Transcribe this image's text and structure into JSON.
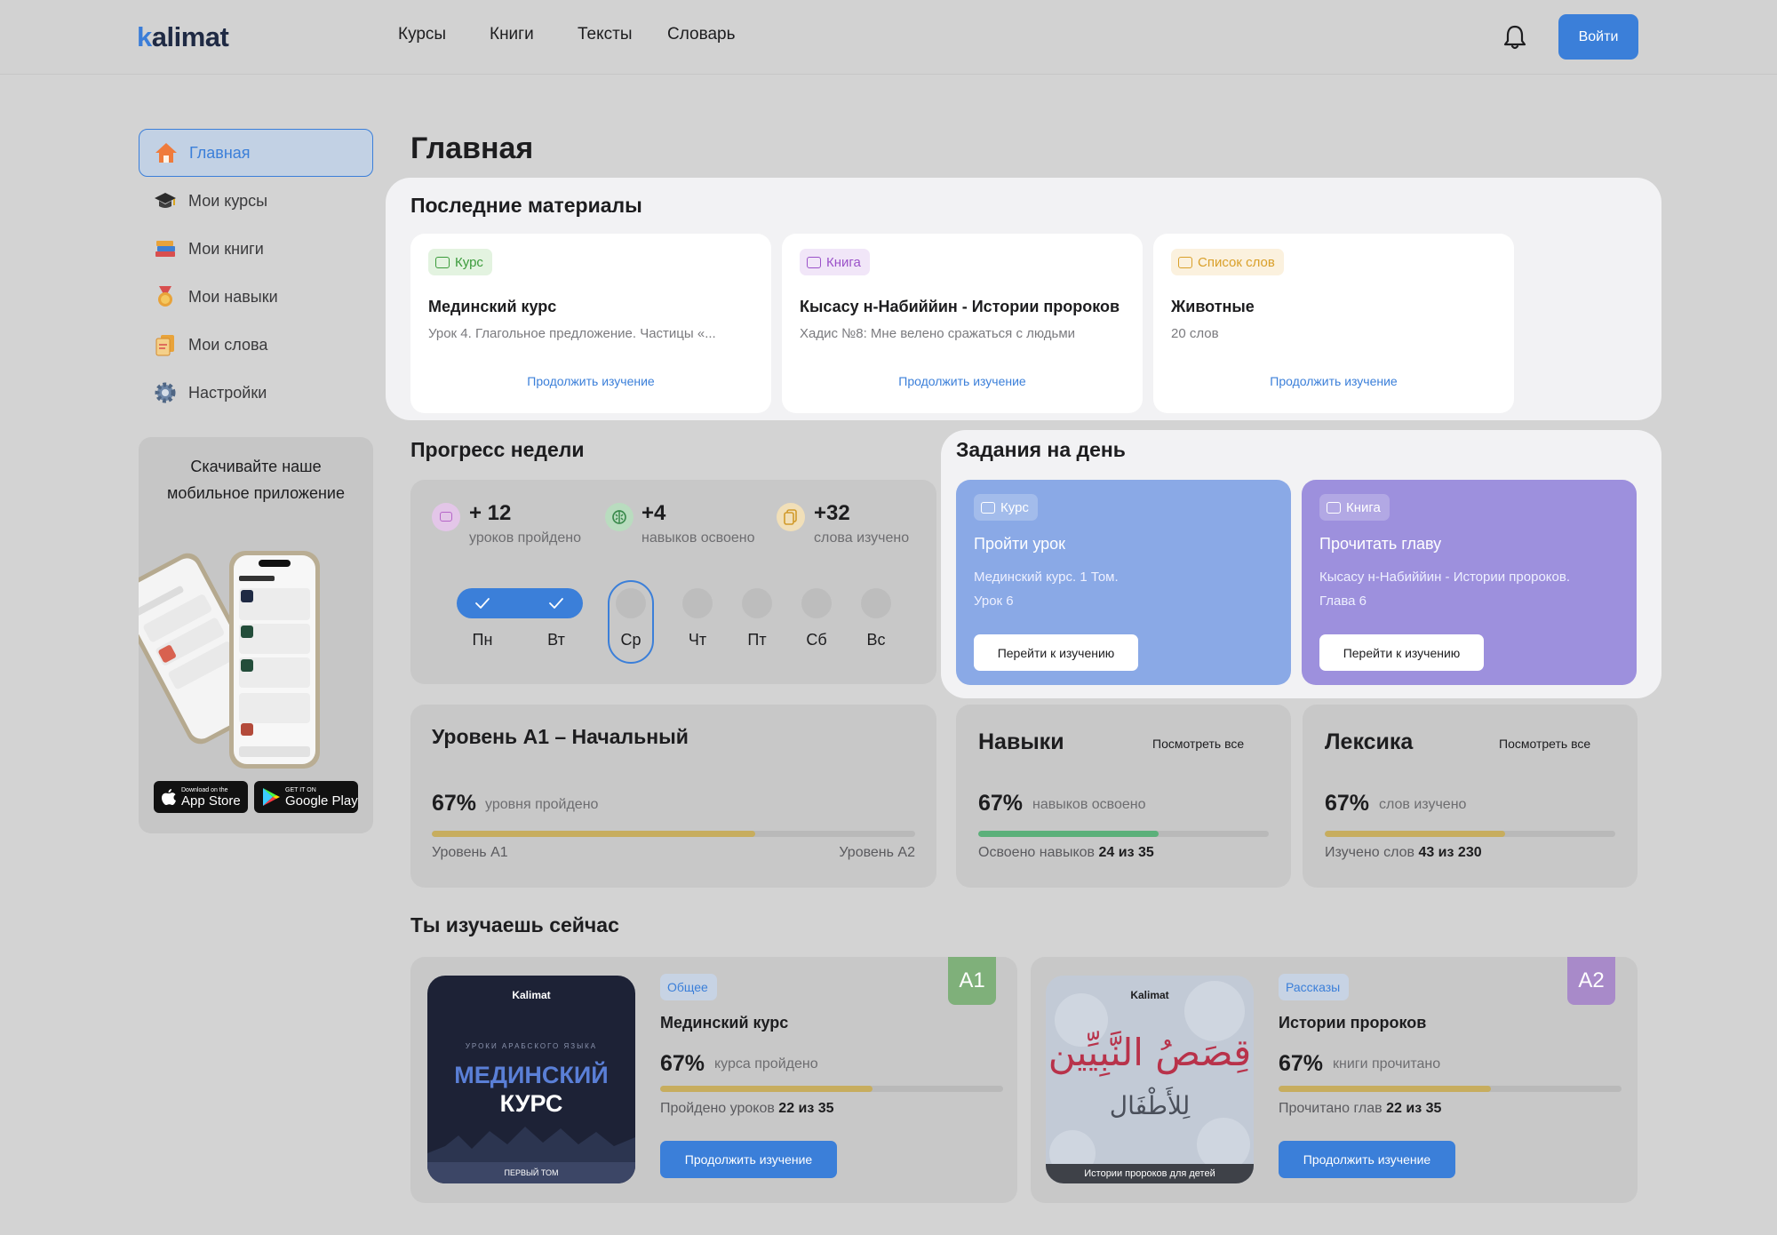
{
  "header": {
    "logo_k": "k",
    "logo_rest": "alimat",
    "nav": [
      "Курсы",
      "Книги",
      "Тексты",
      "Словарь"
    ],
    "login_label": "Войти"
  },
  "sidebar": {
    "items": [
      {
        "label": "Главная",
        "icon": "home-icon"
      },
      {
        "label": "Мои курсы",
        "icon": "graduation-cap-icon"
      },
      {
        "label": "Мои книги",
        "icon": "books-icon"
      },
      {
        "label": "Мои навыки",
        "icon": "medal-icon"
      },
      {
        "label": "Мои слова",
        "icon": "word-cards-icon"
      },
      {
        "label": "Настройки",
        "icon": "gear-icon"
      }
    ],
    "promo": {
      "title_line1": "Скачивайте наше",
      "title_line2": "мобильное приложение",
      "appstore_small": "Download on the",
      "appstore_big": "App Store",
      "gplay_small": "GET IT ON",
      "gplay_big": "Google Play"
    }
  },
  "page_title": "Главная",
  "recent": {
    "title": "Последние материалы",
    "cards": [
      {
        "tag": "Курс",
        "title": "Мединский курс",
        "subtitle": "Урок 4. Глагольное предложение. Частицы «...",
        "link": "Продолжить изучение"
      },
      {
        "tag": "Книга",
        "title": "Кысасу н-Набиййин - Истории пророков",
        "subtitle": "Хадис №8: Мне велено сражаться с людьми",
        "link": "Продолжить изучение"
      },
      {
        "tag": "Список слов",
        "title": "Животные",
        "subtitle": "20 слов",
        "link": "Продолжить изучение"
      }
    ]
  },
  "week": {
    "title": "Прогресс недели",
    "stats": [
      {
        "value": "+ 12",
        "label": "уроков пройдено"
      },
      {
        "value": "+4",
        "label": "навыков освоено"
      },
      {
        "value": "+32",
        "label": "слова изучено"
      }
    ],
    "days": [
      "Пн",
      "Вт",
      "Ср",
      "Чт",
      "Пт",
      "Сб",
      "Вс"
    ],
    "done_days": 2,
    "current_day": 2
  },
  "tasks": {
    "title": "Задания на день",
    "items": [
      {
        "tag": "Курс",
        "title": "Пройти урок",
        "subtitle_line1": "Мединский курс. 1 Том.",
        "subtitle_line2": "Урок 6",
        "button": "Перейти к изучению",
        "color": "#8aa9e6"
      },
      {
        "tag": "Книга",
        "title": "Прочитать главу",
        "subtitle_line1": "Кысасу н-Набиййин - Истории пророков.",
        "subtitle_line2": "Глава 6",
        "button": "Перейти к изучению",
        "color": "#9d90dd"
      }
    ]
  },
  "level": {
    "title": "Уровень А1 – Начальный",
    "percent": "67%",
    "percent_label": "уровня пройдено",
    "progress": 0.67,
    "from": "Уровень А1",
    "to": "Уровень А2"
  },
  "skills": {
    "title": "Навыки",
    "see_all": "Посмотреть все",
    "percent": "67%",
    "percent_label": "навыков освоено",
    "progress": 0.62,
    "count_label": "Освоено навыков",
    "count": "24 из 35"
  },
  "lexicon": {
    "title": "Лексика",
    "see_all": "Посмотреть все",
    "percent": "67%",
    "percent_label": "слов изучено",
    "progress": 0.62,
    "count_label": "Изучено слов",
    "count": "43 из 230"
  },
  "studying": {
    "title": "Ты изучаешь сейчас",
    "items": [
      {
        "category": "Общее",
        "level": "А1",
        "title": "Мединский курс",
        "percent": "67%",
        "percent_label": "курса пройдено",
        "progress": 0.62,
        "count_label": "Пройдено уроков",
        "count": "22 из 35",
        "button": "Продолжить изучение",
        "cover": {
          "brand": "Kalimat",
          "kicker": "УРОКИ АРАБСКОГО ЯЗЫКА",
          "line1": "МЕДИНСКИЙ",
          "line2": "КУРС",
          "footer": "ПЕРВЫЙ ТОМ"
        }
      },
      {
        "category": "Рассказы",
        "level": "А2",
        "title": "Истории пророков",
        "percent": "67%",
        "percent_label": "книги прочитано",
        "progress": 0.62,
        "count_label": "Прочитано глав",
        "count": "22 из 35",
        "button": "Продолжить изучение",
        "cover": {
          "brand": "Kalimat",
          "arabic1": "قِصَصُ النَّبِيِّين",
          "arabic2": "لِلأَطْفَال",
          "footer": "Истории пророков для детей"
        }
      }
    ]
  },
  "colors": {
    "accent": "#3b7fd9",
    "gold": "#c7ad5e",
    "green": "#5bb07a",
    "a1_badge": "#7fb07a",
    "a2_badge": "#a88ac9"
  }
}
